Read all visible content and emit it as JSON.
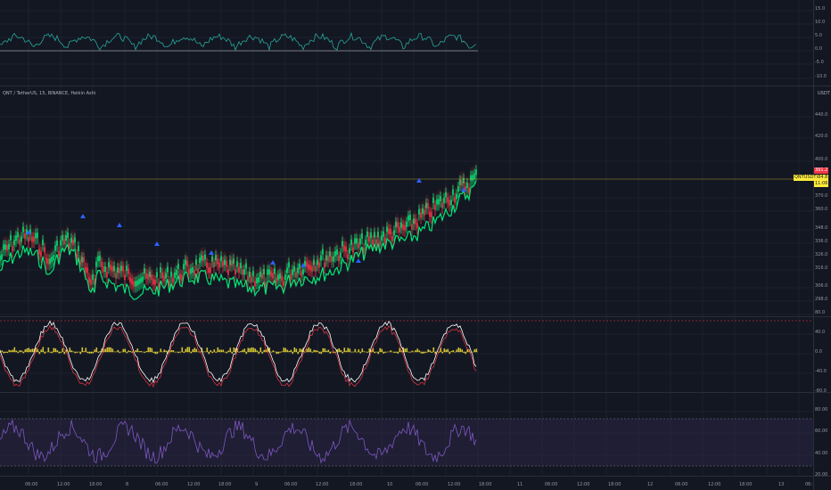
{
  "legend": {
    "text": "QNT / TetherUS, 15, BINANCE, Heikin Ashi"
  },
  "currency": "USDT",
  "price_tags": {
    "high": "391.2",
    "last": "384.8",
    "countdown": "11:06",
    "symbol": "QNTUSDT"
  },
  "osc_top": {
    "ticks": [
      "15.0",
      "10.0",
      "5.0",
      "0.0",
      "-5.0",
      "-10.0"
    ]
  },
  "main": {
    "ticks": [
      "440.0",
      "420.0",
      "400.0",
      "380.0",
      "370.0",
      "360.0",
      "348.0",
      "336.0",
      "326.0",
      "316.0",
      "306.0",
      "298.0"
    ]
  },
  "osc_mid": {
    "ticks": [
      "80.0",
      "40.0",
      "0.0",
      "-40.0",
      "-80.0"
    ]
  },
  "osc_bot": {
    "ticks": [
      "80.00",
      "60.00",
      "40.00",
      "20.00"
    ]
  },
  "time_axis": [
    "06:00",
    "12:00",
    "18:00",
    "8",
    "06:00",
    "12:00",
    "18:00",
    "9",
    "06:00",
    "12:00",
    "18:00",
    "10",
    "06:00",
    "12:00",
    "18:00",
    "11",
    "06:00",
    "12:00",
    "18:00",
    "12",
    "06:00",
    "12:00",
    "18:00",
    "13",
    "06:"
  ],
  "colors": {
    "bg": "#131722",
    "up": "#00e676",
    "down": "#f23645",
    "osc": "#ffeb3b",
    "rsi": "#7e57c2"
  }
}
